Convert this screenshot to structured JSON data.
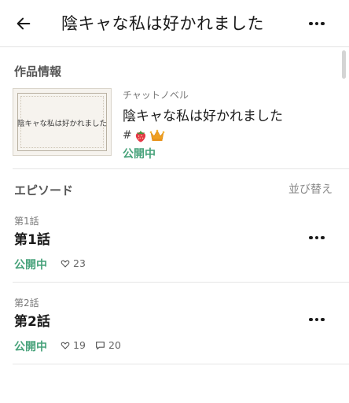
{
  "header": {
    "title": "陰キャな私は好かれました",
    "back_icon": "arrow-left-icon",
    "more_icon": "more-horizontal-icon"
  },
  "work_info": {
    "section_label": "作品情報",
    "thumbnail_text": "陰キャな私は好かれました",
    "genre": "チャットノベル",
    "title": "陰キャな私は好かれました",
    "tags": [
      "#",
      "strawberry-icon",
      "crown-icon"
    ],
    "status": "公開中"
  },
  "episodes_section": {
    "label": "エピソード",
    "sort_label": "並び替え"
  },
  "episodes": [
    {
      "number_label": "第1話",
      "title": "第1話",
      "status": "公開中",
      "likes": "23",
      "comments": null
    },
    {
      "number_label": "第2話",
      "title": "第2話",
      "status": "公開中",
      "likes": "19",
      "comments": "20"
    }
  ],
  "colors": {
    "status_green": "#47a27a",
    "text": "#1a1a1a",
    "muted": "#777777"
  }
}
